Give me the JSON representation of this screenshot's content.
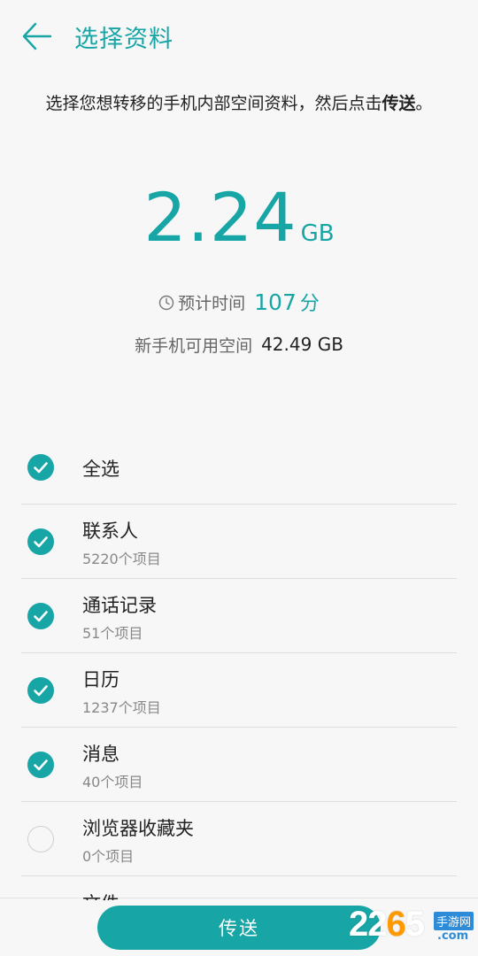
{
  "header": {
    "title": "选择资料"
  },
  "intro": {
    "line_prefix": "选择您想转移的手机内部空间资料，然后点击",
    "emph": "传送",
    "suffix": "。"
  },
  "summary": {
    "size_value": "2.24",
    "size_unit": "GB",
    "time_label": "预计时间",
    "time_value": "107",
    "time_unit": "分",
    "avail_label": "新手机可用空间",
    "avail_value": "42.49 GB"
  },
  "list": [
    {
      "title": "全选",
      "subtitle": "",
      "checked": true
    },
    {
      "title": "联系人",
      "subtitle": "5220个项目",
      "checked": true
    },
    {
      "title": "通话记录",
      "subtitle": "51个项目",
      "checked": true
    },
    {
      "title": "日历",
      "subtitle": "1237个项目",
      "checked": true
    },
    {
      "title": "消息",
      "subtitle": "40个项目",
      "checked": true
    },
    {
      "title": "浏览器收藏夹",
      "subtitle": "0个项目",
      "checked": false
    }
  ],
  "partial_row": {
    "title": "文件"
  },
  "footer": {
    "send_label": "传送"
  },
  "watermark": {
    "number_main": "22",
    "number_accent": "6",
    "number_tail": "5",
    "site": "手游网",
    "domain": ".com"
  },
  "colors": {
    "accent": "#17a5a6",
    "background": "#f7f7f7"
  }
}
